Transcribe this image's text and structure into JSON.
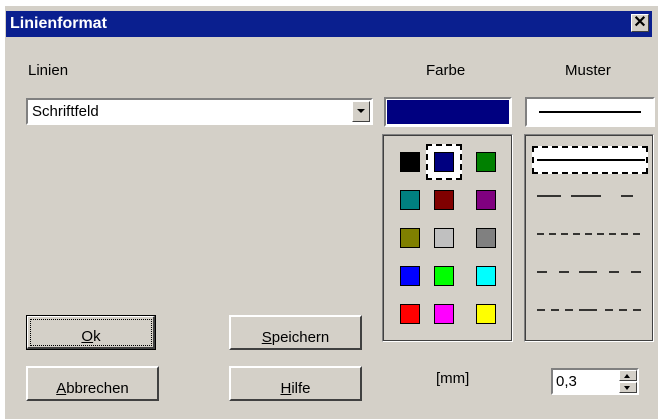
{
  "window": {
    "title": "Linienformat",
    "close_glyph": "✕"
  },
  "labels": {
    "linien": "Linien",
    "farbe": "Farbe",
    "muster": "Muster",
    "unit": "[mm]"
  },
  "linien_select": {
    "value": "Schriftfeld"
  },
  "current_color": "#000080",
  "palette": {
    "colors": [
      [
        "#000000",
        "#000080",
        "#008000"
      ],
      [
        "#008080",
        "#800000",
        "#800080"
      ],
      [
        "#808000",
        "#c0c0c0",
        "#808080"
      ],
      [
        "#0000ff",
        "#00ff00",
        "#00ffff"
      ],
      [
        "#ff0000",
        "#ff00ff",
        "#ffff00"
      ]
    ],
    "selected": "#000080"
  },
  "patterns": {
    "items": [
      "solid",
      "long-dash",
      "short-dash",
      "dash-dot",
      "dash-long-dash"
    ],
    "selected": "solid"
  },
  "buttons": {
    "ok": {
      "mnemonic": "O",
      "rest": "k"
    },
    "speichern": {
      "mnemonic": "S",
      "rest": "peichern"
    },
    "abbrechen": {
      "mnemonic": "A",
      "rest": "bbrechen"
    },
    "hilfe": {
      "mnemonic": "H",
      "rest": "ilfe"
    }
  },
  "line_width": {
    "value": "0,3"
  }
}
